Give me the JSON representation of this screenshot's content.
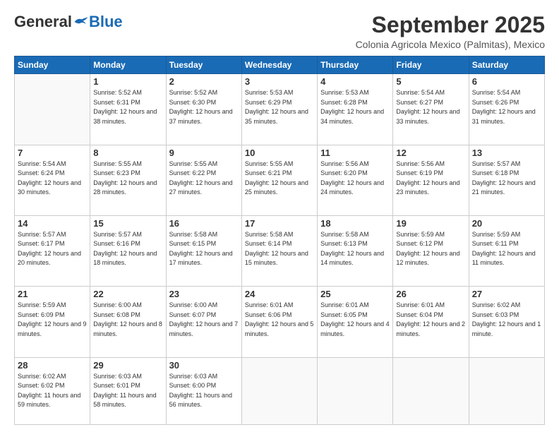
{
  "header": {
    "logo_general": "General",
    "logo_blue": "Blue",
    "month_title": "September 2025",
    "location": "Colonia Agricola Mexico (Palmitas), Mexico"
  },
  "weekdays": [
    "Sunday",
    "Monday",
    "Tuesday",
    "Wednesday",
    "Thursday",
    "Friday",
    "Saturday"
  ],
  "weeks": [
    [
      null,
      {
        "day": 1,
        "sunrise": "Sunrise: 5:52 AM",
        "sunset": "Sunset: 6:31 PM",
        "daylight": "Daylight: 12 hours and 38 minutes."
      },
      {
        "day": 2,
        "sunrise": "Sunrise: 5:52 AM",
        "sunset": "Sunset: 6:30 PM",
        "daylight": "Daylight: 12 hours and 37 minutes."
      },
      {
        "day": 3,
        "sunrise": "Sunrise: 5:53 AM",
        "sunset": "Sunset: 6:29 PM",
        "daylight": "Daylight: 12 hours and 35 minutes."
      },
      {
        "day": 4,
        "sunrise": "Sunrise: 5:53 AM",
        "sunset": "Sunset: 6:28 PM",
        "daylight": "Daylight: 12 hours and 34 minutes."
      },
      {
        "day": 5,
        "sunrise": "Sunrise: 5:54 AM",
        "sunset": "Sunset: 6:27 PM",
        "daylight": "Daylight: 12 hours and 33 minutes."
      },
      {
        "day": 6,
        "sunrise": "Sunrise: 5:54 AM",
        "sunset": "Sunset: 6:26 PM",
        "daylight": "Daylight: 12 hours and 31 minutes."
      }
    ],
    [
      {
        "day": 7,
        "sunrise": "Sunrise: 5:54 AM",
        "sunset": "Sunset: 6:24 PM",
        "daylight": "Daylight: 12 hours and 30 minutes."
      },
      {
        "day": 8,
        "sunrise": "Sunrise: 5:55 AM",
        "sunset": "Sunset: 6:23 PM",
        "daylight": "Daylight: 12 hours and 28 minutes."
      },
      {
        "day": 9,
        "sunrise": "Sunrise: 5:55 AM",
        "sunset": "Sunset: 6:22 PM",
        "daylight": "Daylight: 12 hours and 27 minutes."
      },
      {
        "day": 10,
        "sunrise": "Sunrise: 5:55 AM",
        "sunset": "Sunset: 6:21 PM",
        "daylight": "Daylight: 12 hours and 25 minutes."
      },
      {
        "day": 11,
        "sunrise": "Sunrise: 5:56 AM",
        "sunset": "Sunset: 6:20 PM",
        "daylight": "Daylight: 12 hours and 24 minutes."
      },
      {
        "day": 12,
        "sunrise": "Sunrise: 5:56 AM",
        "sunset": "Sunset: 6:19 PM",
        "daylight": "Daylight: 12 hours and 23 minutes."
      },
      {
        "day": 13,
        "sunrise": "Sunrise: 5:57 AM",
        "sunset": "Sunset: 6:18 PM",
        "daylight": "Daylight: 12 hours and 21 minutes."
      }
    ],
    [
      {
        "day": 14,
        "sunrise": "Sunrise: 5:57 AM",
        "sunset": "Sunset: 6:17 PM",
        "daylight": "Daylight: 12 hours and 20 minutes."
      },
      {
        "day": 15,
        "sunrise": "Sunrise: 5:57 AM",
        "sunset": "Sunset: 6:16 PM",
        "daylight": "Daylight: 12 hours and 18 minutes."
      },
      {
        "day": 16,
        "sunrise": "Sunrise: 5:58 AM",
        "sunset": "Sunset: 6:15 PM",
        "daylight": "Daylight: 12 hours and 17 minutes."
      },
      {
        "day": 17,
        "sunrise": "Sunrise: 5:58 AM",
        "sunset": "Sunset: 6:14 PM",
        "daylight": "Daylight: 12 hours and 15 minutes."
      },
      {
        "day": 18,
        "sunrise": "Sunrise: 5:58 AM",
        "sunset": "Sunset: 6:13 PM",
        "daylight": "Daylight: 12 hours and 14 minutes."
      },
      {
        "day": 19,
        "sunrise": "Sunrise: 5:59 AM",
        "sunset": "Sunset: 6:12 PM",
        "daylight": "Daylight: 12 hours and 12 minutes."
      },
      {
        "day": 20,
        "sunrise": "Sunrise: 5:59 AM",
        "sunset": "Sunset: 6:11 PM",
        "daylight": "Daylight: 12 hours and 11 minutes."
      }
    ],
    [
      {
        "day": 21,
        "sunrise": "Sunrise: 5:59 AM",
        "sunset": "Sunset: 6:09 PM",
        "daylight": "Daylight: 12 hours and 9 minutes."
      },
      {
        "day": 22,
        "sunrise": "Sunrise: 6:00 AM",
        "sunset": "Sunset: 6:08 PM",
        "daylight": "Daylight: 12 hours and 8 minutes."
      },
      {
        "day": 23,
        "sunrise": "Sunrise: 6:00 AM",
        "sunset": "Sunset: 6:07 PM",
        "daylight": "Daylight: 12 hours and 7 minutes."
      },
      {
        "day": 24,
        "sunrise": "Sunrise: 6:01 AM",
        "sunset": "Sunset: 6:06 PM",
        "daylight": "Daylight: 12 hours and 5 minutes."
      },
      {
        "day": 25,
        "sunrise": "Sunrise: 6:01 AM",
        "sunset": "Sunset: 6:05 PM",
        "daylight": "Daylight: 12 hours and 4 minutes."
      },
      {
        "day": 26,
        "sunrise": "Sunrise: 6:01 AM",
        "sunset": "Sunset: 6:04 PM",
        "daylight": "Daylight: 12 hours and 2 minutes."
      },
      {
        "day": 27,
        "sunrise": "Sunrise: 6:02 AM",
        "sunset": "Sunset: 6:03 PM",
        "daylight": "Daylight: 12 hours and 1 minute."
      }
    ],
    [
      {
        "day": 28,
        "sunrise": "Sunrise: 6:02 AM",
        "sunset": "Sunset: 6:02 PM",
        "daylight": "Daylight: 11 hours and 59 minutes."
      },
      {
        "day": 29,
        "sunrise": "Sunrise: 6:03 AM",
        "sunset": "Sunset: 6:01 PM",
        "daylight": "Daylight: 11 hours and 58 minutes."
      },
      {
        "day": 30,
        "sunrise": "Sunrise: 6:03 AM",
        "sunset": "Sunset: 6:00 PM",
        "daylight": "Daylight: 11 hours and 56 minutes."
      },
      null,
      null,
      null,
      null
    ]
  ]
}
